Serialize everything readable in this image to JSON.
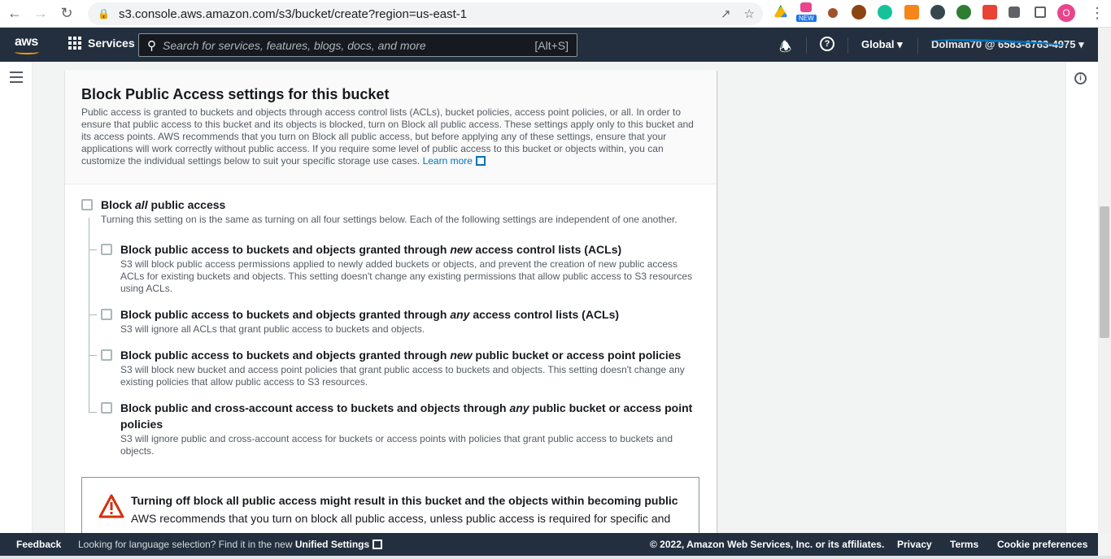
{
  "browser": {
    "url": "s3.console.aws.amazon.com/s3/bucket/create?region=us-east-1",
    "new_badge": "NEW",
    "profile_initial": "O"
  },
  "aws_nav": {
    "logo": "aws",
    "services": "Services",
    "search_placeholder": "Search for services, features, blogs, docs, and more",
    "search_shortcut": "[Alt+S]",
    "region": "Global",
    "account": "Dolman70 @ 6583-8763-4975"
  },
  "panel": {
    "title": "Block Public Access settings for this bucket",
    "description": "Public access is granted to buckets and objects through access control lists (ACLs), bucket policies, access point policies, or all. In order to ensure that public access to this bucket and its objects is blocked, turn on Block all public access. These settings apply only to this bucket and its access points. AWS recommends that you turn on Block all public access, but before applying any of these settings, ensure that your applications will work correctly without public access. If you require some level of public access to this bucket or objects within, you can customize the individual settings below to suit your specific storage use cases.",
    "learn_more": "Learn more",
    "block_all": {
      "title_pre": "Block ",
      "title_em": "all",
      "title_post": " public access",
      "desc": "Turning this setting on is the same as turning on all four settings below. Each of the following settings are independent of one another.",
      "checked": false
    },
    "options": [
      {
        "title_pre": "Block public access to buckets and objects granted through ",
        "title_em": "new",
        "title_post": " access control lists (ACLs)",
        "desc": "S3 will block public access permissions applied to newly added buckets or objects, and prevent the creation of new public access ACLs for existing buckets and objects. This setting doesn't change any existing permissions that allow public access to S3 resources using ACLs.",
        "checked": false
      },
      {
        "title_pre": "Block public access to buckets and objects granted through ",
        "title_em": "any",
        "title_post": " access control lists (ACLs)",
        "desc": "S3 will ignore all ACLs that grant public access to buckets and objects.",
        "checked": false
      },
      {
        "title_pre": "Block public access to buckets and objects granted through ",
        "title_em": "new",
        "title_post": " public bucket or access point policies",
        "desc": "S3 will block new bucket and access point policies that grant public access to buckets and objects. This setting doesn't change any existing policies that allow public access to S3 resources.",
        "checked": false
      },
      {
        "title_pre": "Block public and cross-account access to buckets and objects through ",
        "title_em": "any",
        "title_post": " public bucket or access point policies",
        "desc": "S3 will ignore public and cross-account access for buckets or access points with policies that grant public access to buckets and objects.",
        "checked": false
      }
    ],
    "warning": {
      "title": "Turning off block all public access might result in this bucket and the objects within becoming public",
      "text": "AWS recommends that you turn on block all public access, unless public access is required for specific and"
    }
  },
  "footer": {
    "feedback": "Feedback",
    "lang_text": "Looking for language selection? Find it in the new ",
    "unified_settings": "Unified Settings",
    "copyright": "© 2022, Amazon Web Services, Inc. or its affiliates.",
    "privacy": "Privacy",
    "terms": "Terms",
    "cookie": "Cookie preferences"
  },
  "colors": {
    "aws_nav_bg": "#232f3e",
    "link": "#0073bb",
    "aws_orange": "#ff9900"
  }
}
